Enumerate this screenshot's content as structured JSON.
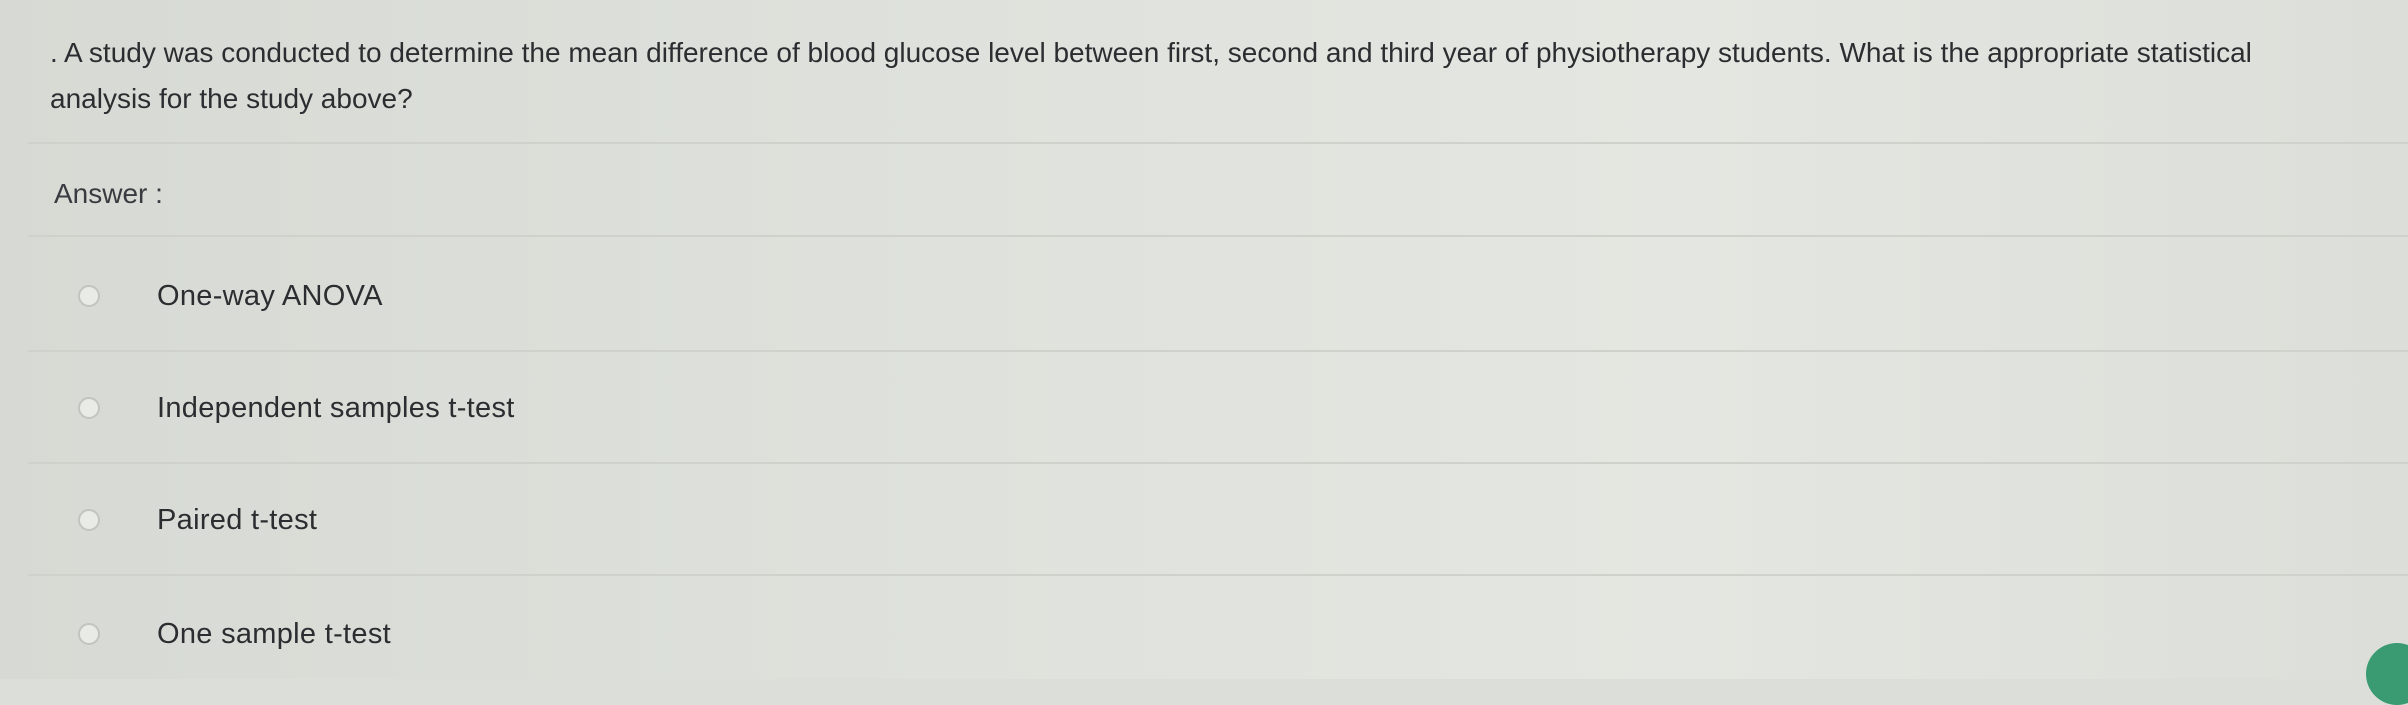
{
  "question": {
    "text": ". A study was conducted to determine the mean difference of blood glucose level between first, second and third year of physiotherapy students. What is the appropriate statistical analysis for the study above?"
  },
  "answer": {
    "label": "Answer :",
    "options": [
      {
        "label": "One-way ANOVA",
        "selected": false
      },
      {
        "label": "Independent samples t-test",
        "selected": false
      },
      {
        "label": "Paired t-test",
        "selected": false
      },
      {
        "label": "One sample t-test",
        "selected": false
      }
    ]
  },
  "colors": {
    "background": "#dcdfd9",
    "text": "#2c2d31",
    "radio_border": "#c2c4c0",
    "badge": "#3a9b72"
  }
}
